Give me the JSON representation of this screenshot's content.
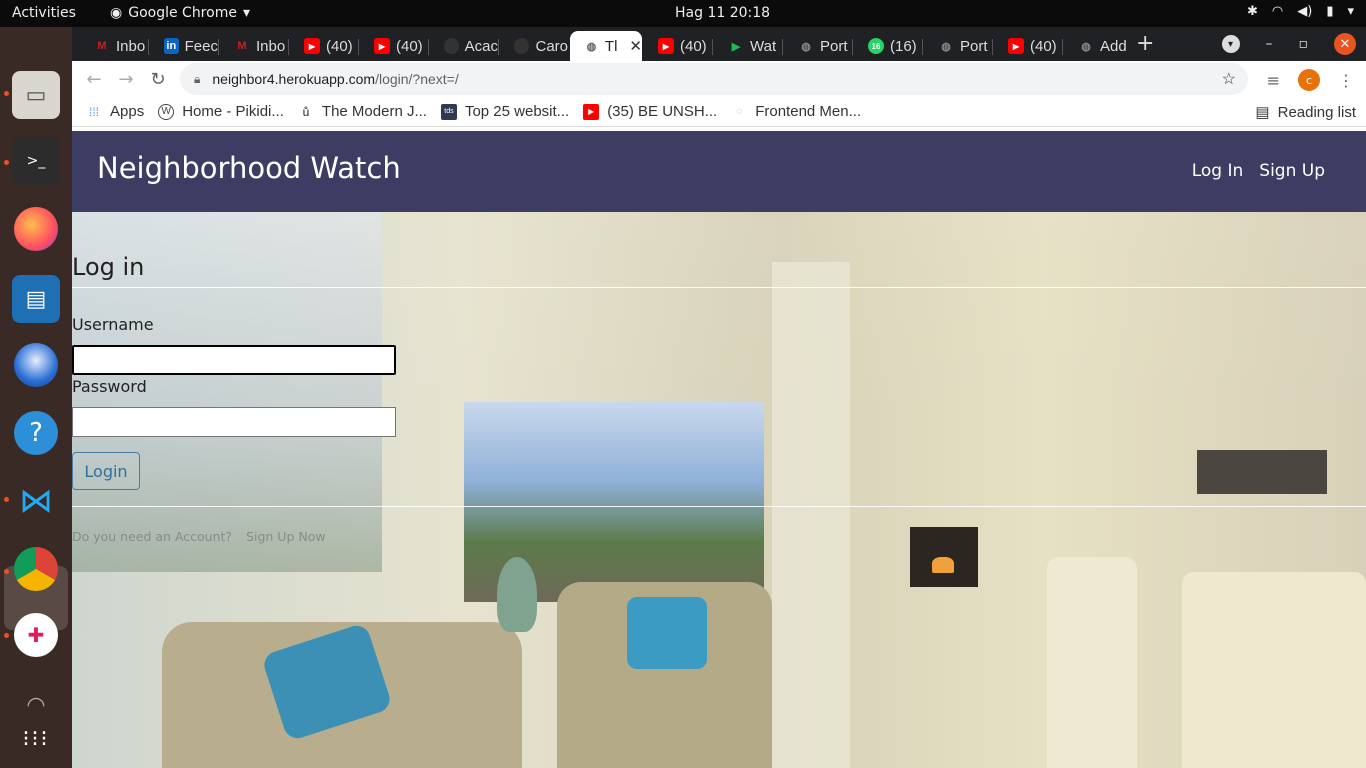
{
  "topbar": {
    "activities": "Activities",
    "app": "Google Chrome",
    "clock": "Hag 11  20:18"
  },
  "tabs": [
    {
      "label": "Inbo",
      "icon": "gmail-icon",
      "color": "#c5221f"
    },
    {
      "label": "Feec",
      "icon": "linkedin-icon",
      "color": "#0a66c2"
    },
    {
      "label": "Inbo",
      "icon": "gmail-icon",
      "color": "#c5221f"
    },
    {
      "label": "(40)",
      "icon": "youtube-icon",
      "color": "#ff0000"
    },
    {
      "label": "(40)",
      "icon": "youtube-icon",
      "color": "#ff0000"
    },
    {
      "label": "Acac",
      "icon": "github-icon",
      "color": "#333333"
    },
    {
      "label": "Caro",
      "icon": "github-icon",
      "color": "#333333"
    },
    {
      "label": "Tl",
      "icon": "globe-icon",
      "color": "#5f6368",
      "active": true
    },
    {
      "label": "(40)",
      "icon": "youtube-icon",
      "color": "#ff0000"
    },
    {
      "label": "Wat",
      "icon": "play-icon",
      "color": "#1db954"
    },
    {
      "label": "Port",
      "icon": "globe-icon",
      "color": "#888888"
    },
    {
      "label": "(16)",
      "icon": "whatsapp-icon",
      "color": "#25d366"
    },
    {
      "label": "Port",
      "icon": "globe-icon",
      "color": "#888888"
    },
    {
      "label": "(40)",
      "icon": "youtube-icon",
      "color": "#ff0000"
    },
    {
      "label": "Add",
      "icon": "globe-icon",
      "color": "#888888"
    }
  ],
  "omnibox": {
    "host": "neighbor4.herokuapp.com",
    "path": "/login/?next=/"
  },
  "profile_initial": "c",
  "bookmarks": [
    {
      "label": "Apps"
    },
    {
      "label": "Home - Pikidi..."
    },
    {
      "label": "The Modern J..."
    },
    {
      "label": "Top 25 websit..."
    },
    {
      "label": "(35) BE UNSH..."
    },
    {
      "label": "Frontend Men..."
    }
  ],
  "reading_list": "Reading list",
  "site": {
    "brand": "Neighborhood Watch",
    "nav": {
      "login": "Log In",
      "signup": "Sign Up"
    }
  },
  "form": {
    "title": "Log in",
    "username_label": "Username",
    "username_value": "",
    "password_label": "Password",
    "password_value": "",
    "submit": "Login",
    "need_account": "Do you need an Account?",
    "signup_link": "Sign Up Now"
  }
}
